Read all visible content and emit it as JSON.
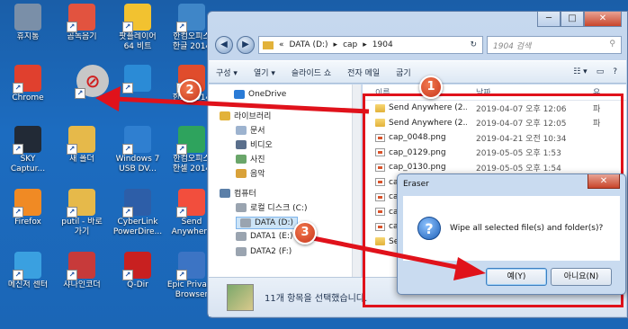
{
  "desktop": {
    "icons": [
      {
        "label": "휴지통",
        "color": "#7a8fa8",
        "icon": "recycle-bin-icon"
      },
      {
        "label": "곰녹음기",
        "color": "#e2533f",
        "icon": "gom-recorder-icon"
      },
      {
        "label": "팟플레이어\n64 비트",
        "color": "#f2c230",
        "icon": "potplayer-icon"
      },
      {
        "label": "한컴오피스\n한글 2014",
        "color": "#3f86c8",
        "icon": "hancom-hangul-icon"
      },
      {
        "label": "Chrome",
        "color": "#e0402e",
        "icon": "chrome-icon"
      },
      {
        "label": "",
        "color": "#c7c7c7",
        "icon": "eraser-icon"
      },
      {
        "label": "",
        "color": "#2b8bd6",
        "icon": "shortcut-icon"
      },
      {
        "label": "한쇼 2014",
        "color": "#e04c2c",
        "icon": "hancom-show-icon"
      },
      {
        "label": "SKY\nCaptur...",
        "color": "#222a36",
        "icon": "sky-capture-icon"
      },
      {
        "label": "새 폴더",
        "color": "#e6b94a",
        "icon": "folder-icon"
      },
      {
        "label": "Windows 7\nUSB DV...",
        "color": "#2f7fd0",
        "icon": "windows-usb-icon"
      },
      {
        "label": "한컴오피스\n한셀 2014",
        "color": "#2ea35d",
        "icon": "hancom-cell-icon"
      },
      {
        "label": "Firefox",
        "color": "#f08a24",
        "icon": "firefox-icon"
      },
      {
        "label": "putil - 바로\n가기",
        "color": "#e6b94a",
        "icon": "folder-icon"
      },
      {
        "label": "CyberLink\nPowerDire...",
        "color": "#2d5ea8",
        "icon": "cyberlink-icon"
      },
      {
        "label": "Send\nAnywhere",
        "color": "#f24e3d",
        "icon": "send-anywhere-icon"
      },
      {
        "label": "메신저 센터",
        "color": "#3aa0e0",
        "icon": "messenger-icon"
      },
      {
        "label": "샤나인코더",
        "color": "#c73a3a",
        "icon": "shana-encoder-icon"
      },
      {
        "label": "Q-Dir",
        "color": "#c82020",
        "icon": "q-dir-icon"
      },
      {
        "label": "Epic Privacy\nBrowser",
        "color": "#3c74c4",
        "icon": "epic-browser-icon"
      }
    ]
  },
  "explorer": {
    "window_controls": [
      "─",
      "□",
      "✕"
    ],
    "address": {
      "prefix": "«",
      "path": [
        "DATA (D:)",
        "cap",
        "1904"
      ],
      "refresh": "↻"
    },
    "search_placeholder": "1904 검색",
    "toolbar": [
      "구성 ▾",
      "열기 ▾",
      "슬라이드 쇼",
      "전자 메일",
      "굽기"
    ],
    "nav": [
      {
        "label": "OneDrive",
        "color": "#2a7bd6",
        "icon": "onedrive-icon"
      },
      {
        "label": "라이브러리",
        "color": "#e2b23a",
        "icon": "library-icon"
      },
      {
        "label": "문서",
        "color": "#9db3cf",
        "icon": "documents-icon"
      },
      {
        "label": "비디오",
        "color": "#5a6f8c",
        "icon": "video-icon"
      },
      {
        "label": "사진",
        "color": "#6aa66a",
        "icon": "pictures-icon"
      },
      {
        "label": "음악",
        "color": "#d9a23a",
        "icon": "music-icon"
      },
      {
        "label": "컴퓨터",
        "color": "#5b7fa8",
        "icon": "computer-icon"
      },
      {
        "label": "로컬 디스크 (C:)",
        "color": "#9aa4b0",
        "icon": "drive-icon"
      },
      {
        "label": "DATA (D:)",
        "color": "#9aa4b0",
        "icon": "drive-icon"
      },
      {
        "label": "DATA1 (E:)",
        "color": "#9aa4b0",
        "icon": "drive-icon"
      },
      {
        "label": "DATA2 (F:)",
        "color": "#9aa4b0",
        "icon": "drive-icon"
      }
    ],
    "columns": {
      "name": "이름",
      "date": "날짜",
      "type": "유"
    },
    "files": [
      {
        "name": "Send Anywhere (2...",
        "date": "2019-04-07 오후 12:06",
        "type": "파",
        "kind": "folder"
      },
      {
        "name": "Send Anywhere (2...",
        "date": "2019-04-07 오후 12:05",
        "type": "파",
        "kind": "folder"
      },
      {
        "name": "cap_0048.png",
        "date": "2019-04-21 오전 10:34",
        "type": "",
        "kind": "png"
      },
      {
        "name": "cap_0129.png",
        "date": "2019-05-05 오후 1:53",
        "type": "",
        "kind": "png"
      },
      {
        "name": "cap_0130.png",
        "date": "2019-05-05 오후 1:54",
        "type": "",
        "kind": "png"
      },
      {
        "name": "ca",
        "date": "",
        "type": "",
        "kind": "png"
      },
      {
        "name": "ca",
        "date": "",
        "type": "",
        "kind": "png"
      },
      {
        "name": "ca",
        "date": "",
        "type": "",
        "kind": "png"
      },
      {
        "name": "ca",
        "date": "",
        "type": "",
        "kind": "png"
      },
      {
        "name": "Se",
        "date": "",
        "type": "",
        "kind": "folder"
      }
    ],
    "status": "11개 항목을 선택했습니다."
  },
  "dialog": {
    "title": "Eraser",
    "close": "✕",
    "message": "Wipe all selected file(s) and folder(s)?",
    "icon": "question-icon",
    "yes": "예(Y)",
    "no": "아니요(N)"
  },
  "steps": [
    "1",
    "2",
    "3"
  ],
  "colors": {
    "annotation_red": "#e0121b",
    "badge": "#d9442a"
  }
}
